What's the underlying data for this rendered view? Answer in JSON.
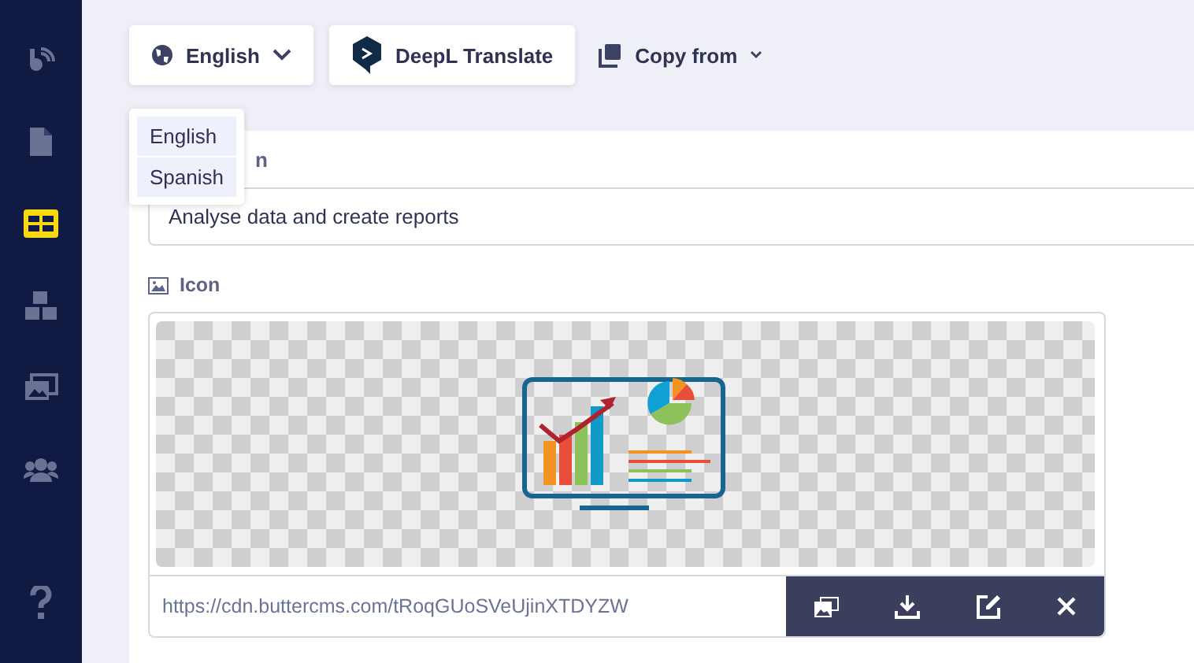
{
  "sidebar": {
    "items": [
      {
        "kind": "blog",
        "selected": false
      },
      {
        "kind": "page",
        "selected": false
      },
      {
        "kind": "collection",
        "selected": true
      },
      {
        "kind": "components",
        "selected": false
      },
      {
        "kind": "media",
        "selected": false
      },
      {
        "kind": "users",
        "selected": false
      },
      {
        "kind": "help",
        "selected": false
      }
    ]
  },
  "toolbar": {
    "language": "English",
    "translate": "DeepL Translate",
    "copy": "Copy from"
  },
  "language_menu": [
    "English",
    "Spanish"
  ],
  "field_label_visible": "n",
  "field_value": "Analyse data and create reports",
  "icon_field": {
    "label": "Icon",
    "url": "https://cdn.buttercms.com/tRoqGUoSVeUjinXTDYZW",
    "actions": [
      {
        "kind": "media"
      },
      {
        "kind": "download"
      },
      {
        "kind": "edit"
      },
      {
        "kind": "remove"
      }
    ]
  }
}
